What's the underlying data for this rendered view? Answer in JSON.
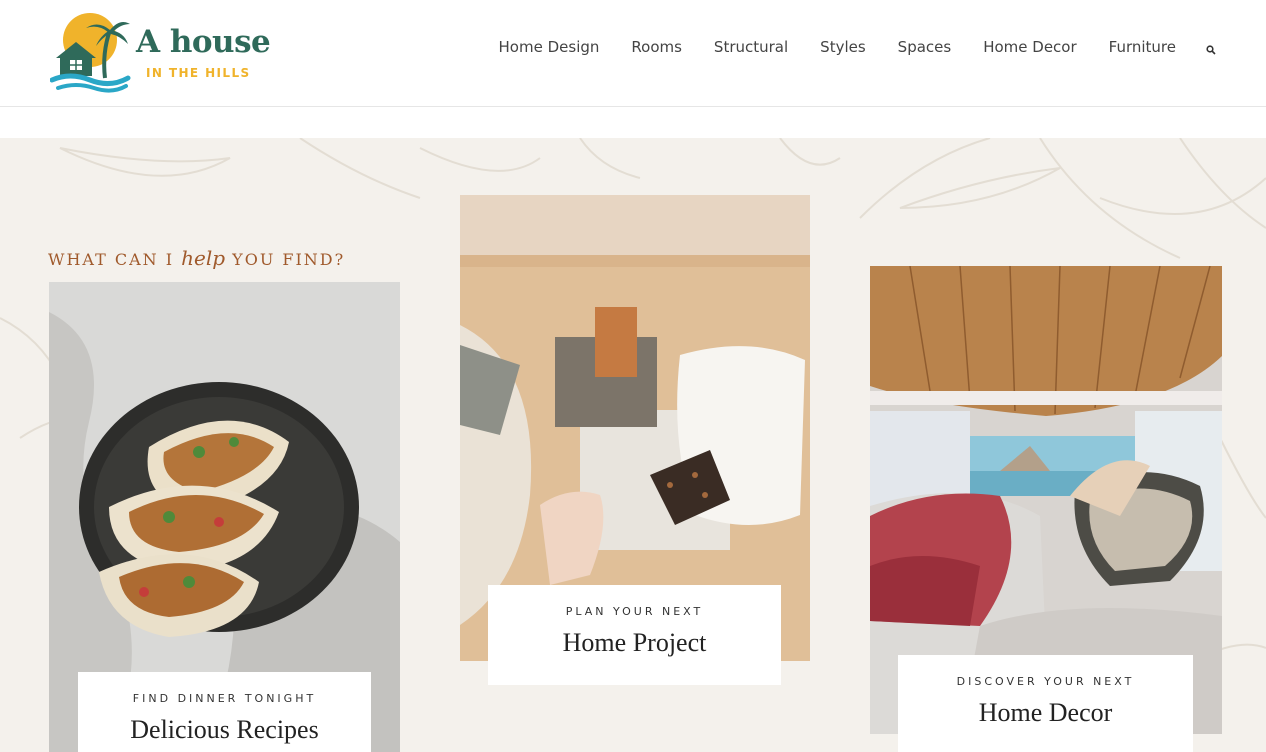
{
  "brand": {
    "name_main": "A house",
    "name_sub": "IN THE HILLS",
    "colors": {
      "green": "#2f6a5a",
      "yellow": "#f0b32b",
      "teal": "#2aa7c7"
    }
  },
  "nav": {
    "items": [
      {
        "label": "Home Design"
      },
      {
        "label": "Rooms"
      },
      {
        "label": "Structural"
      },
      {
        "label": "Styles"
      },
      {
        "label": "Spaces"
      },
      {
        "label": "Home Decor"
      },
      {
        "label": "Furniture"
      }
    ],
    "search_icon": "search-icon"
  },
  "finder": {
    "eyebrow_before": "WHAT CAN I ",
    "eyebrow_script": "help",
    "eyebrow_after": " YOU FIND?",
    "cards": [
      {
        "kicker": "FIND DINNER TONIGHT",
        "title": "Delicious Recipes",
        "image": "tacos-photo"
      },
      {
        "kicker": "PLAN YOUR NEXT",
        "title": "Home Project",
        "image": "material-samples-photo"
      },
      {
        "kicker": "DISCOVER YOUR NEXT",
        "title": "Home Decor",
        "image": "camper-van-interior-photo"
      }
    ]
  }
}
